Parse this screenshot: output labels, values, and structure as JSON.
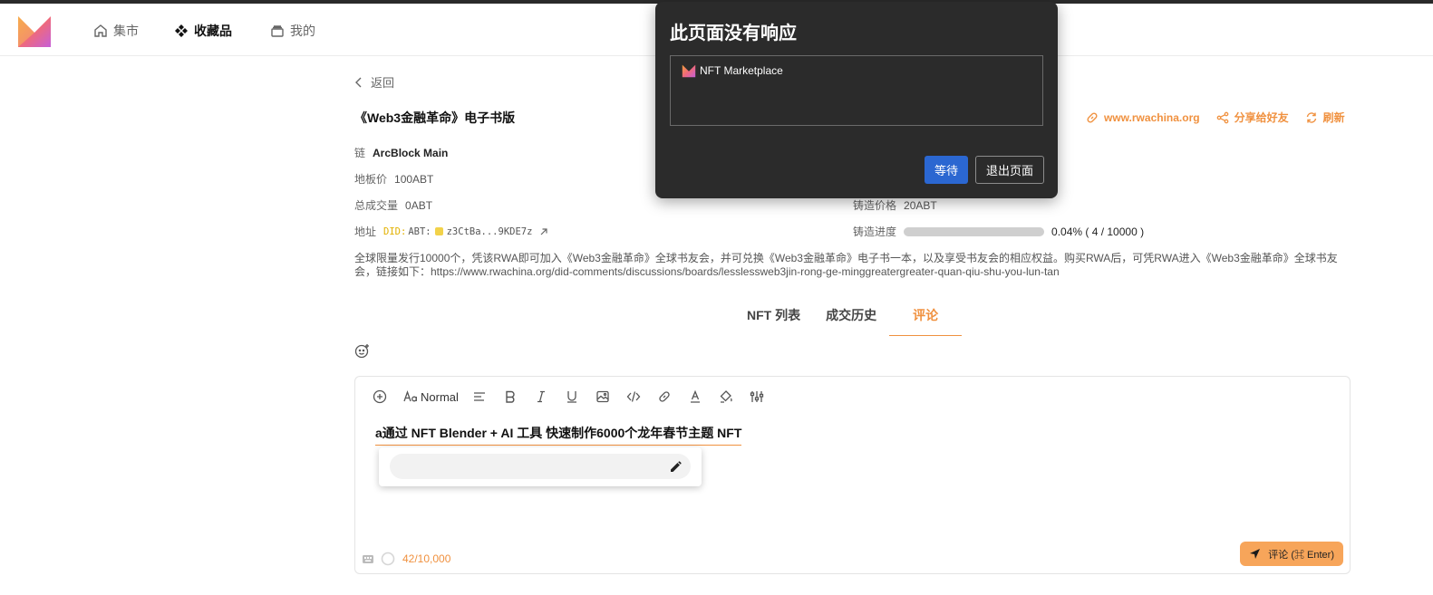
{
  "nav": {
    "items": [
      {
        "label": "集市",
        "icon": "home-icon"
      },
      {
        "label": "收藏品",
        "icon": "diamond-grid-icon"
      },
      {
        "label": "我的",
        "icon": "wallet-icon"
      }
    ]
  },
  "back_label": "返回",
  "collection": {
    "title": "《Web3金融革命》电子书版",
    "actions": {
      "site": "www.rwachina.org",
      "share": "分享给好友",
      "refresh": "刷新"
    },
    "chain_label": "链",
    "chain_value": "ArcBlock Main",
    "floor_label": "地板价",
    "floor_value": "100ABT",
    "volume_label": "总成交量",
    "volume_value": "0ABT",
    "address_label": "地址",
    "address_prefix": "DID:",
    "address_mid": "ABT:",
    "address_value": "z3CtBa...9KDE7z",
    "mint_price_label": "铸造价格",
    "mint_price_value": "20ABT",
    "mint_progress_label": "铸造进度",
    "mint_progress_text": "0.04% ( 4 / 10000 )",
    "mint_progress_fraction": 0.0004,
    "description": "全球限量发行10000个，凭该RWA即可加入《Web3金融革命》全球书友会，并可兑换《Web3金融革命》电子书一本，以及享受书友会的相应权益。购买RWA后，可凭RWA进入《Web3金融革命》全球书友会，链接如下：https://www.rwachina.org/did-comments/discussions/boards/lesslessweb3jin-rong-ge-minggreatergreater-quan-qiu-shu-you-lun-tan"
  },
  "tabs": [
    "NFT 列表",
    "成交历史",
    "评论"
  ],
  "editor": {
    "format_label": "Normal",
    "content": "a通过 NFT Blender + AI 工具 快速制作6000个龙年春节主题 NFT",
    "link_value": "",
    "char_count": "42/10,000",
    "submit_label": "评论 (⌘ Enter)"
  },
  "dialog": {
    "title": "此页面没有响应",
    "page_name": "NFT Marketplace",
    "wait_label": "等待",
    "exit_label": "退出页面"
  },
  "colors": {
    "accent": "#f0913f",
    "dialog_bg": "#2b2b2b",
    "primary_button": "#2b67d1"
  }
}
